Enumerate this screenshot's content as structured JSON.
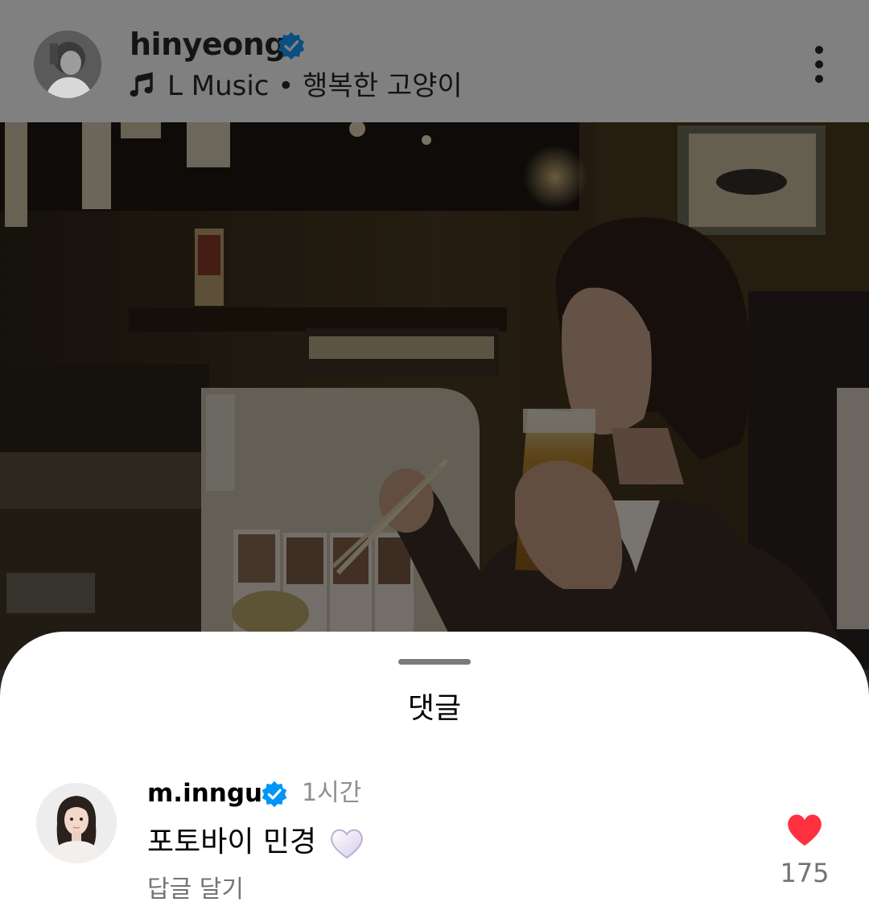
{
  "post_header": {
    "username": "hinyeong",
    "verified": true,
    "music_label": "L Music • 행복한 고양이",
    "icons": {
      "verified": "verified-badge-icon",
      "music": "music-note-icon",
      "more": "more-options-icon"
    }
  },
  "comments_sheet": {
    "title": "댓글",
    "comments": [
      {
        "username": "m.inngu",
        "verified": true,
        "time": "1시간",
        "text": "포토바이 민경",
        "emoji": "white-heart-emoji",
        "reply_label": "답글 달기",
        "like_count": "175",
        "liked": true
      }
    ]
  },
  "colors": {
    "verified_blue": "#0095f6",
    "like_red": "#ff3040",
    "dim_overlay": "#808080",
    "secondary_text": "#737373"
  }
}
